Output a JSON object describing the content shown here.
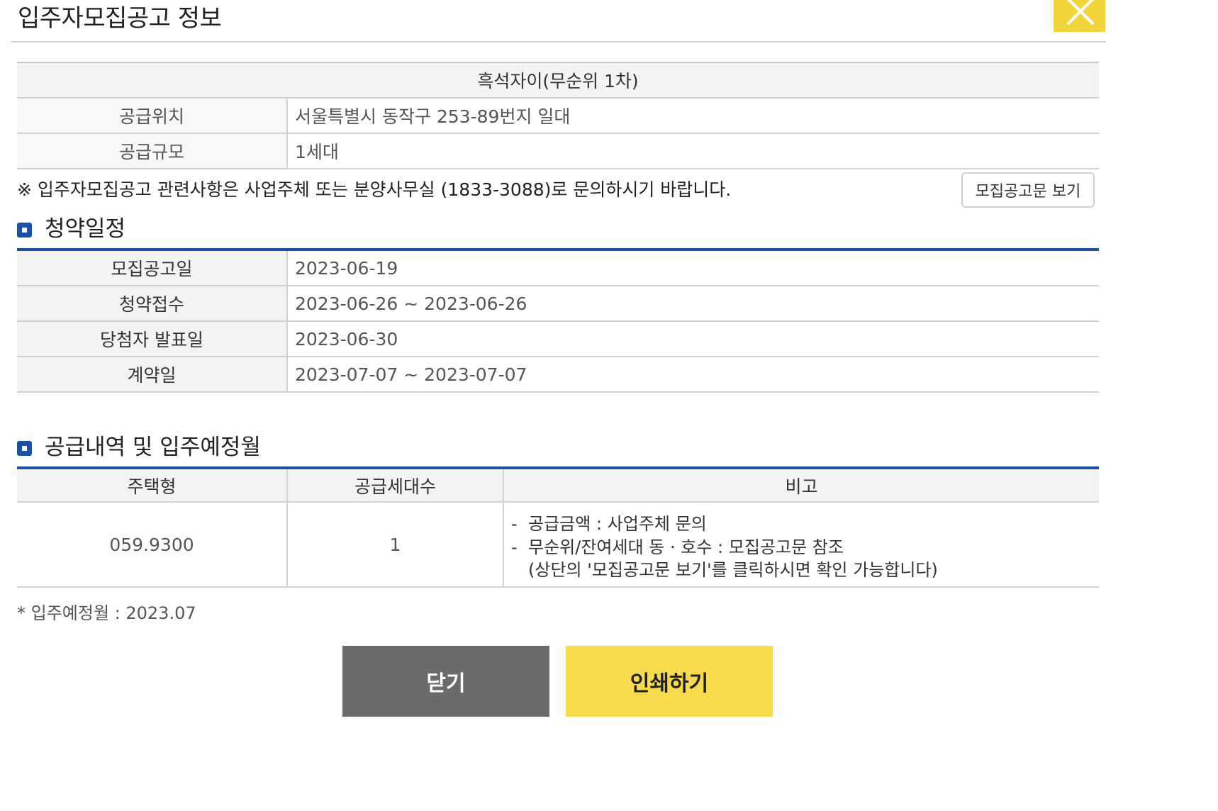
{
  "modal": {
    "title": "입주자모집공고 정보"
  },
  "info": {
    "complex_name": "흑석자이(무순위 1차)",
    "rows": [
      {
        "label": "공급위치",
        "value": "서울특별시 동작구 253-89번지 일대"
      },
      {
        "label": "공급규모",
        "value": "1세대"
      }
    ]
  },
  "notice": "※ 입주자모집공고 관련사항은 사업주체 또는 분양사무실 (1833-3088)로 문의하시기 바랍니다.",
  "doc_button_label": "모집공고문 보기",
  "schedule": {
    "title": "청약일정",
    "rows": [
      {
        "label": "모집공고일",
        "value": "2023-06-19"
      },
      {
        "label": "청약접수",
        "value": "2023-06-26 ~ 2023-06-26"
      },
      {
        "label": "당첨자 발표일",
        "value": "2023-06-30"
      },
      {
        "label": "계약일",
        "value": "2023-07-07 ~ 2023-07-07"
      }
    ]
  },
  "supply": {
    "title": "공급내역 및 입주예정월",
    "headers": [
      "주택형",
      "공급세대수",
      "비고"
    ],
    "row": {
      "type": "059.9300",
      "units": "1",
      "notes": [
        "공급금액 : 사업주체 문의",
        "무순위/잔여세대 동 · 호수 : 모집공고문 참조"
      ],
      "note_sub": "(상단의 '모집공고문 보기'를 클릭하시면 확인 가능합니다)"
    }
  },
  "move_in": "* 입주예정월 : 2023.07",
  "buttons": {
    "close": "닫기",
    "print": "인쇄하기"
  },
  "colors": {
    "accent_blue": "#1d4fa3",
    "accent_yellow": "#f8dc4e",
    "close_gray": "#6b6b6b"
  }
}
